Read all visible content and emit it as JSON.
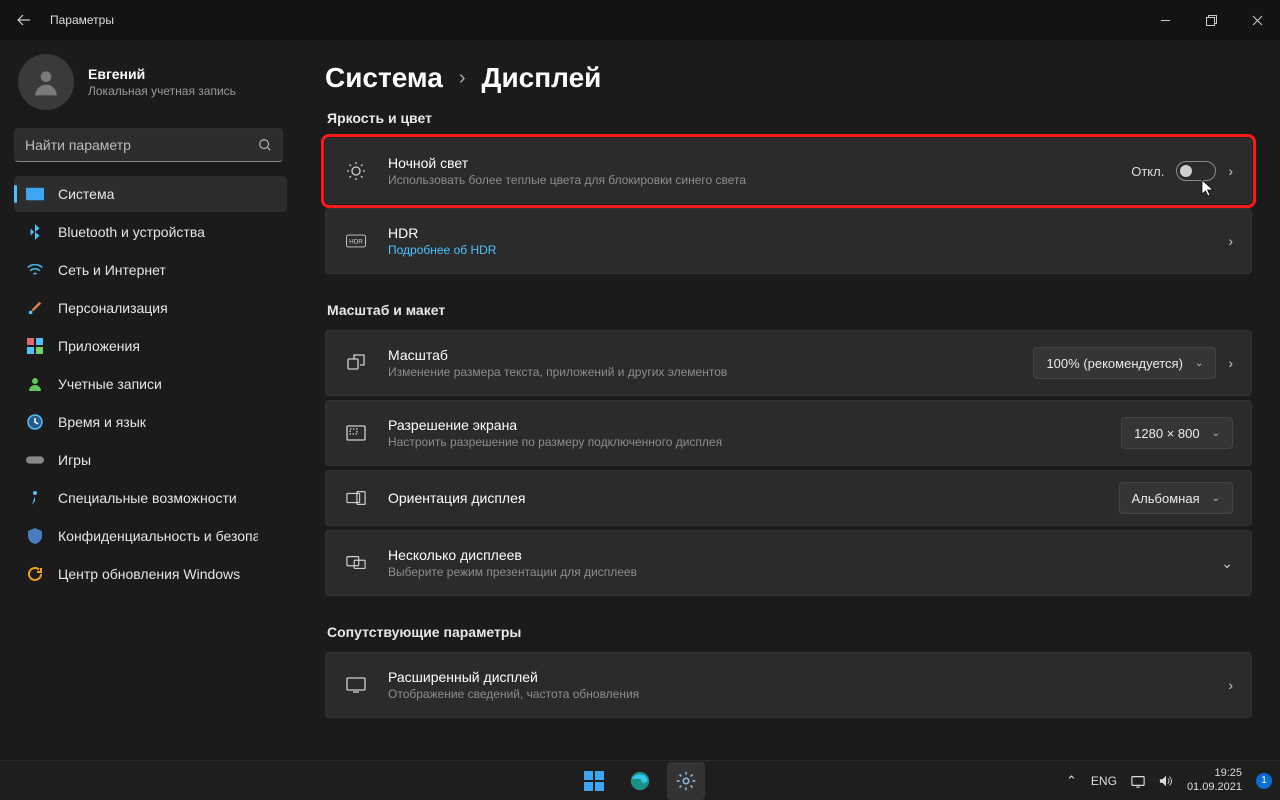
{
  "titlebar": {
    "title": "Параметры"
  },
  "user": {
    "name": "Евгений",
    "type": "Локальная учетная запись"
  },
  "search": {
    "placeholder": "Найти параметр"
  },
  "sidebar": {
    "items": [
      {
        "label": "Система"
      },
      {
        "label": "Bluetooth и устройства"
      },
      {
        "label": "Сеть и Интернет"
      },
      {
        "label": "Персонализация"
      },
      {
        "label": "Приложения"
      },
      {
        "label": "Учетные записи"
      },
      {
        "label": "Время и язык"
      },
      {
        "label": "Игры"
      },
      {
        "label": "Специальные возможности"
      },
      {
        "label": "Конфиденциальность и безопасность"
      },
      {
        "label": "Центр обновления Windows"
      }
    ]
  },
  "breadcrumb": {
    "parent": "Система",
    "current": "Дисплей"
  },
  "sections": {
    "brightness": {
      "title": "Яркость и цвет",
      "night": {
        "title": "Ночной свет",
        "subtitle": "Использовать более теплые цвета для блокировки синего света",
        "toggle_label": "Откл."
      },
      "hdr": {
        "title": "HDR",
        "subtitle": "Подробнее об HDR"
      }
    },
    "scale": {
      "title": "Масштаб и макет",
      "scale": {
        "title": "Масштаб",
        "subtitle": "Изменение размера текста, приложений и других элементов",
        "value": "100% (рекомендуется)"
      },
      "resolution": {
        "title": "Разрешение экрана",
        "subtitle": "Настроить разрешение по размеру подключенного дисплея",
        "value": "1280 × 800"
      },
      "orientation": {
        "title": "Ориентация дисплея",
        "value": "Альбомная"
      },
      "multi": {
        "title": "Несколько дисплеев",
        "subtitle": "Выберите режим презентации для дисплеев"
      }
    },
    "related": {
      "title": "Сопутствующие параметры",
      "advanced": {
        "title": "Расширенный дисплей",
        "subtitle": "Отображение сведений, частота обновления"
      }
    }
  },
  "select_chevron": "⌄",
  "card_arrow": "›",
  "expand_arrow": "⌄",
  "taskbar": {
    "lang": "ENG",
    "time": "19:25",
    "date": "01.09.2021",
    "notif_count": "1",
    "tray_chevron": "⌃"
  }
}
